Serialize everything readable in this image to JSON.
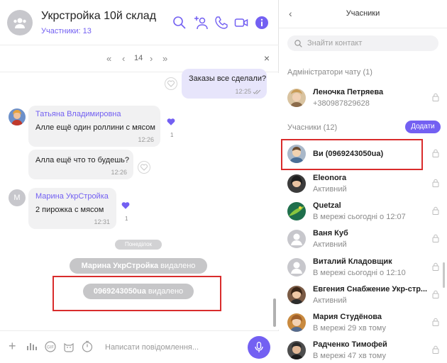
{
  "chat": {
    "title": "Укрстройка 10й склад",
    "members": "Участники: 13",
    "pager": {
      "first": "«",
      "prev": "‹",
      "page": "14",
      "next": "›",
      "last": "»",
      "close": "×"
    },
    "messages": {
      "outgoing": {
        "text": "Заказы все сделали?",
        "time": "12:25"
      },
      "m1": {
        "sender": "Татьяна Владимировна",
        "text": "Алле ещё один роллини с мясом",
        "time": "12:26",
        "likes": "1"
      },
      "m2": {
        "text": "Алла ещё что то будешь?",
        "time": "12:26"
      },
      "m3": {
        "sender": "Марина УкрСтройка",
        "avatar_letter": "М",
        "text": "2 пирожка с мясом",
        "time": "12:31",
        "likes": "1"
      }
    },
    "day_separator": "Понеділок",
    "system": [
      {
        "name": "Марина УкрСтройка",
        "action": "видалено"
      },
      {
        "name": "0969243050ua",
        "action": "видалено"
      }
    ],
    "composer": {
      "placeholder": "Написати повідомлення..."
    }
  },
  "panel": {
    "title": "Учасники",
    "back": "‹",
    "search_placeholder": "Знайти контакт",
    "admins_title": "Адміністратори чату (1)",
    "members_title": "Учасники (12)",
    "add_label": "Додати",
    "admin": {
      "name": "Леночка Петряева",
      "status": "+380987829628"
    },
    "members": [
      {
        "name": "Ви (0969243050ua)",
        "status": ""
      },
      {
        "name": "Eleonora",
        "status": "Активний"
      },
      {
        "name": "Quetzal",
        "status": "В мережі сьогодні о 12:07"
      },
      {
        "name": "Ваня Куб",
        "status": "Активний"
      },
      {
        "name": "Виталий Кладовщик",
        "status": "В мережі сьогодні о 12:10"
      },
      {
        "name": "Евгения Снабжение Укр-стр...",
        "status": "Активний"
      },
      {
        "name": "Мария Студёнова",
        "status": "В мережі 29 хв тому"
      },
      {
        "name": "Радченко Тимофей",
        "status": "В мережі 47 хв тому"
      }
    ]
  },
  "colors": {
    "accent": "#7360f2",
    "highlight": "#d92c2c",
    "pill": "#c6c6c8"
  },
  "icons": [
    "search-icon",
    "add-participant-icon",
    "phone-icon",
    "video-icon",
    "info-icon",
    "heart-icon",
    "lock-icon",
    "mic-icon",
    "plus-icon",
    "gif-icon",
    "sticker-icon",
    "timer-icon",
    "audio-icon"
  ]
}
